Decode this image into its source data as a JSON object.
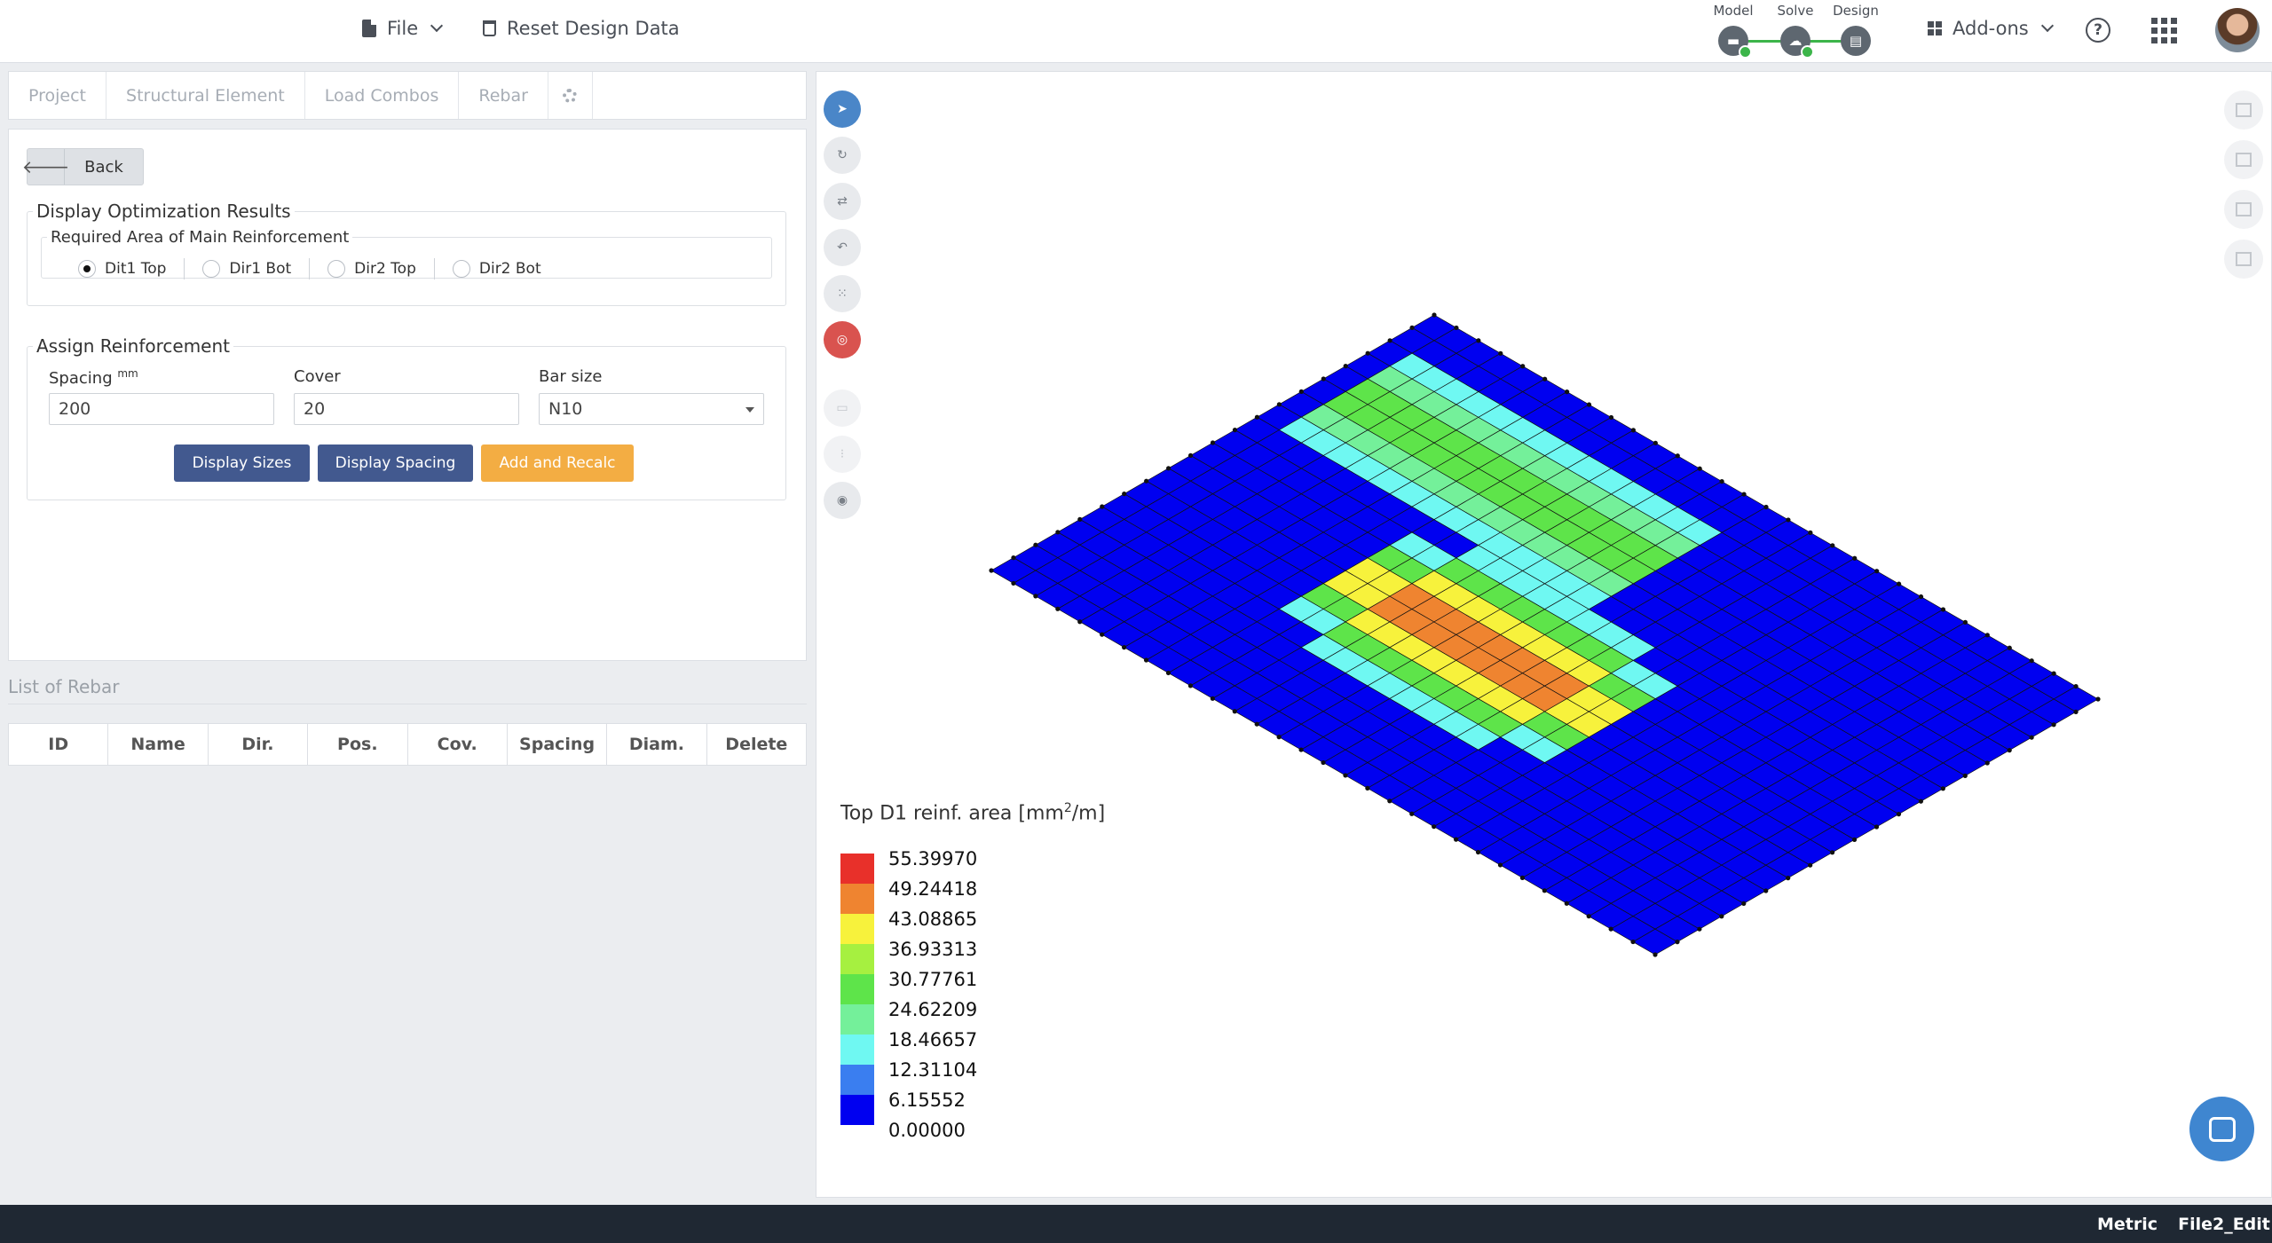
{
  "header": {
    "file_label": "File",
    "reset_label": "Reset Design Data",
    "workflow": [
      {
        "label": "Model",
        "icon": "beam-icon"
      },
      {
        "label": "Solve",
        "icon": "cloud-check-icon"
      },
      {
        "label": "Design",
        "icon": "report-icon"
      }
    ],
    "addons_label": "Add-ons",
    "help_glyph": "?"
  },
  "tabs": [
    "Project",
    "Structural Element",
    "Load Combos",
    "Rebar"
  ],
  "panel": {
    "back_label": "Back",
    "display_legend": "Display Optimization Results",
    "required_legend": "Required Area of Main Reinforcement",
    "radios": [
      {
        "label": "Dit1 Top",
        "checked": true
      },
      {
        "label": "Dir1 Bot",
        "checked": false
      },
      {
        "label": "Dir2 Top",
        "checked": false
      },
      {
        "label": "Dir2 Bot",
        "checked": false
      }
    ],
    "assign_legend": "Assign Reinforcement",
    "spacing_label": "Spacing",
    "spacing_unit": "mm",
    "spacing_value": "200",
    "cover_label": "Cover",
    "cover_value": "20",
    "barsize_label": "Bar size",
    "barsize_value": "N10",
    "btn_sizes": "Display Sizes",
    "btn_spacing": "Display Spacing",
    "btn_add": "Add and Recalc"
  },
  "rebar_list": {
    "title": "List of Rebar",
    "columns": [
      "ID",
      "Name",
      "Dir.",
      "Pos.",
      "Cov.",
      "Spacing",
      "Diam.",
      "Delete"
    ]
  },
  "legend": {
    "title_main": "Top D1 reinf. area [mm",
    "title_sup": "2",
    "title_end": "/m]",
    "values": [
      "55.39970",
      "49.24418",
      "43.08865",
      "36.93313",
      "30.77761",
      "24.62209",
      "18.46657",
      "12.31104",
      "6.15552",
      "0.00000"
    ],
    "colors": [
      "#e8302a",
      "#ef8430",
      "#f7f23c",
      "#a6f040",
      "#5ee44a",
      "#74f09a",
      "#6ff8f2",
      "#3a7ef0",
      "#0000f0"
    ]
  },
  "contour": {
    "grid_cols": 30,
    "grid_rows": 20,
    "palette": [
      "#0000f0",
      "#3a7ef0",
      "#6ff8f2",
      "#74f09a",
      "#5ee44a",
      "#a6f040",
      "#f7f23c",
      "#ef8430",
      "#e8302a"
    ]
  },
  "status": {
    "units": "Metric",
    "file": "File2_Edit"
  }
}
